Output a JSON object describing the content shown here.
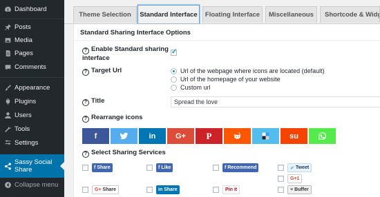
{
  "sidebar": {
    "items": [
      {
        "label": "Dashboard",
        "icon": "dashboard-icon"
      },
      {
        "label": "Posts",
        "icon": "pushpin-icon"
      },
      {
        "label": "Media",
        "icon": "media-icon"
      },
      {
        "label": "Pages",
        "icon": "pages-icon"
      },
      {
        "label": "Comments",
        "icon": "comments-icon"
      },
      {
        "label": "Appearance",
        "icon": "paintbrush-icon"
      },
      {
        "label": "Plugins",
        "icon": "plug-icon"
      },
      {
        "label": "Users",
        "icon": "user-icon"
      },
      {
        "label": "Tools",
        "icon": "wrench-icon"
      },
      {
        "label": "Settings",
        "icon": "settings-icon"
      },
      {
        "label": "Sassy Social Share",
        "icon": "share-icon"
      }
    ],
    "collapse_label": "Collapse menu",
    "colors": {
      "bg": "#23282d",
      "active": "#0073aa"
    }
  },
  "tabs": [
    {
      "label": "Theme Selection"
    },
    {
      "label": "Standard Interface"
    },
    {
      "label": "Floating Interface"
    },
    {
      "label": "Miscellaneous"
    },
    {
      "label": "Shortcode & Widget"
    }
  ],
  "panel": {
    "title": "Standard Sharing Interface Options",
    "enable_label_1": "Enable Standard sharing",
    "enable_label_2": "interface",
    "enable_checked": true,
    "target_label": "Target Url",
    "target_options": [
      {
        "label": "Url of the webpage where icons are located (default)",
        "selected": true
      },
      {
        "label": "Url of the homepage of your website",
        "selected": false
      },
      {
        "label": "Custom url",
        "selected": false
      }
    ],
    "title_label": "Title",
    "title_value": "Spread the love",
    "rearrange_label": "Rearrange icons",
    "icons": [
      {
        "name": "facebook",
        "glyph": "f",
        "color": "#3c589a"
      },
      {
        "name": "twitter",
        "glyph": "",
        "color": "#55acee"
      },
      {
        "name": "linkedin",
        "glyph": "in",
        "color": "#0077b5"
      },
      {
        "name": "google-plus",
        "glyph": "G+",
        "color": "#dd4b39"
      },
      {
        "name": "pinterest",
        "glyph": "P",
        "color": "#cc2329"
      },
      {
        "name": "reddit",
        "glyph": "",
        "color": "#ff5700"
      },
      {
        "name": "delicious",
        "glyph": "",
        "color": "#53beee"
      },
      {
        "name": "stumbleupon",
        "glyph": "su",
        "color": "#f74300"
      },
      {
        "name": "whatsapp",
        "glyph": "",
        "color": "#55eb4c"
      }
    ],
    "services_label": "Select Sharing Services",
    "services": [
      {
        "label": "Share",
        "style": "fb"
      },
      {
        "label": "Like",
        "style": "fb"
      },
      {
        "label": "Recommend",
        "style": "fb"
      },
      {
        "label": "Tweet",
        "style": "tw"
      },
      {
        "label": "G+1",
        "style": "gp"
      },
      {
        "label": "Share",
        "style": "gs"
      },
      {
        "label": "Share",
        "style": "li"
      },
      {
        "label": "Pin it",
        "style": "pin"
      },
      {
        "label": "Buffer",
        "style": "buf"
      }
    ]
  }
}
